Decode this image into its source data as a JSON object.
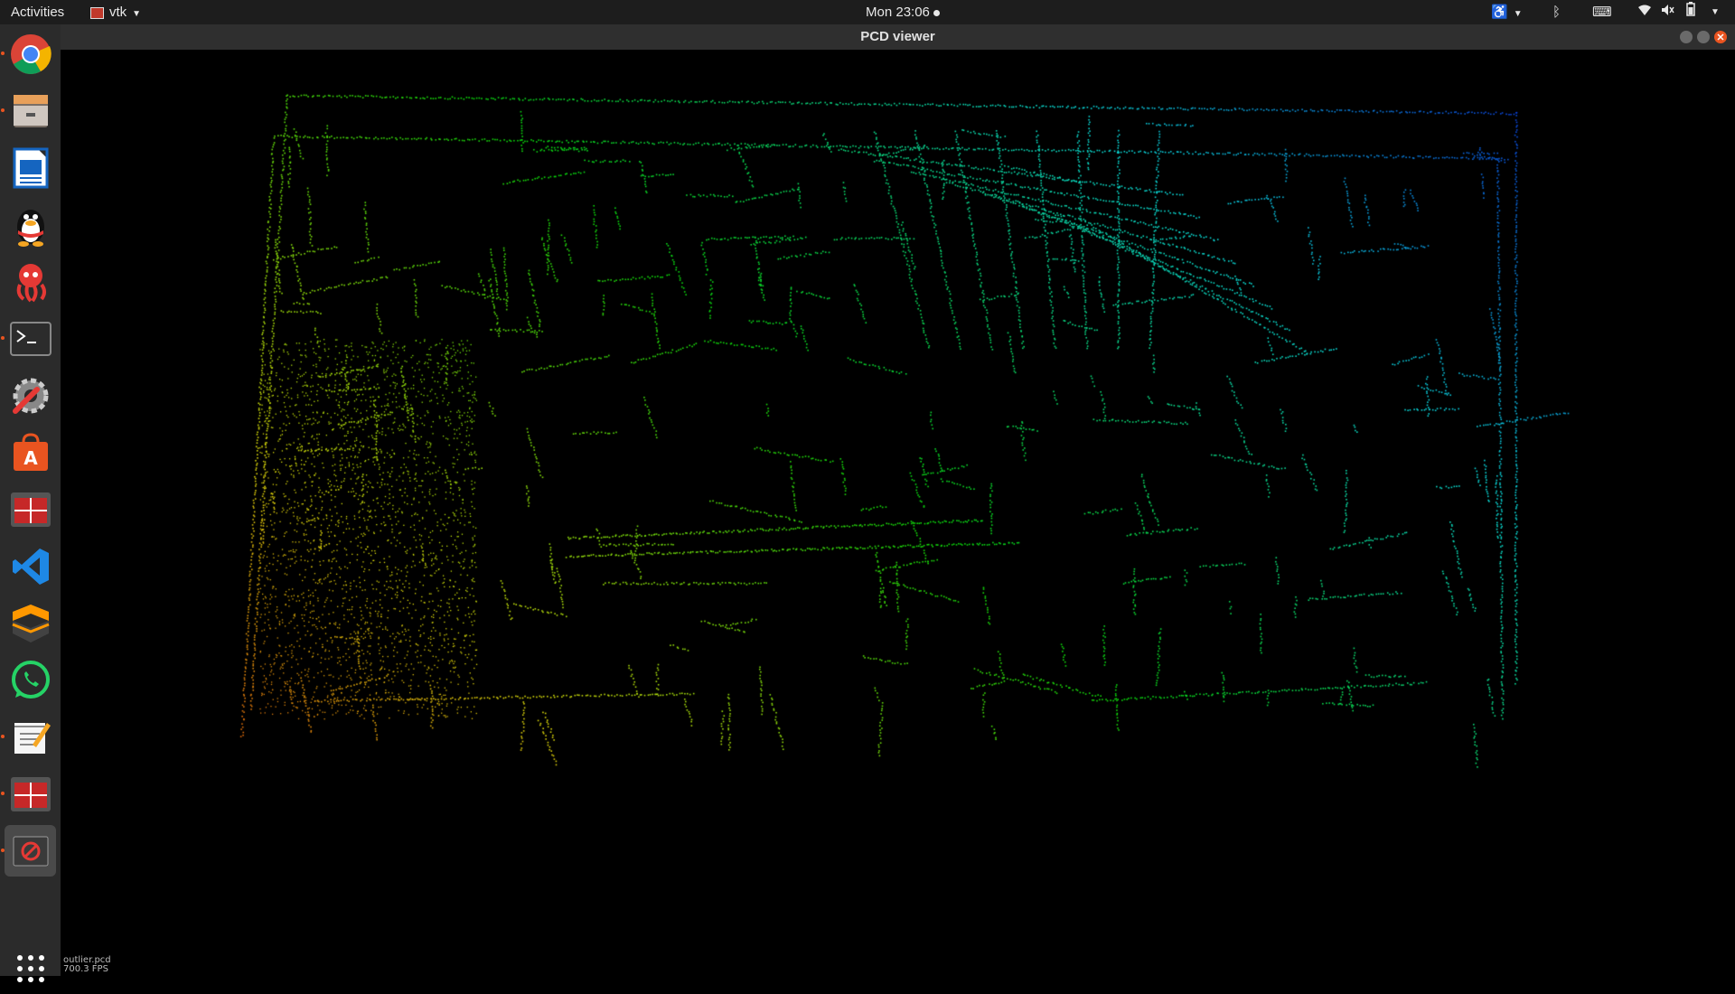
{
  "topbar": {
    "activities": "Activities",
    "app_menu": "vtk",
    "clock": "Mon 23:06"
  },
  "window": {
    "title": "PCD viewer"
  },
  "viewer": {
    "fps_text": "700.3 FPS",
    "file_text": "outlier.pcd",
    "background": "#000000",
    "colors": {
      "low": "#ff2a00",
      "mid": "#66cc00",
      "high_green": "#22cc66",
      "cyan": "#22cccc",
      "blue": "#1144ff"
    }
  },
  "dock": {
    "items": [
      {
        "name": "chrome-icon",
        "running": true
      },
      {
        "name": "files-icon",
        "running": true
      },
      {
        "name": "libreoffice-writer-icon",
        "running": false
      },
      {
        "name": "qq-penguin-icon",
        "running": false
      },
      {
        "name": "red-octopus-app-icon",
        "running": false
      },
      {
        "name": "terminal-icon",
        "running": true
      },
      {
        "name": "system-tools-icon",
        "running": false
      },
      {
        "name": "software-center-icon",
        "running": false
      },
      {
        "name": "red-grid-app-icon",
        "running": false
      },
      {
        "name": "vscode-icon",
        "running": false
      },
      {
        "name": "sublime-text-icon",
        "running": false
      },
      {
        "name": "whatsapp-icon",
        "running": false
      },
      {
        "name": "text-editor-icon",
        "running": true
      },
      {
        "name": "red-grid-app-2-icon",
        "running": true
      },
      {
        "name": "pcd-viewer-icon",
        "running": true
      },
      {
        "name": "show-apps-icon",
        "running": false
      }
    ]
  }
}
